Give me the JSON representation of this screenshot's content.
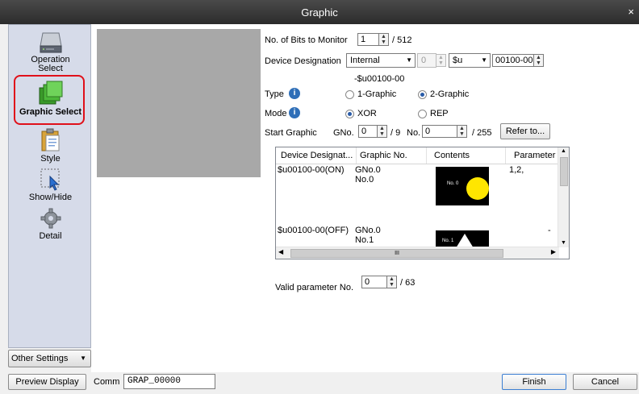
{
  "window": {
    "title": "Graphic",
    "close_glyph": "×"
  },
  "sidebar": {
    "items": [
      {
        "label": "Operation\nSelect",
        "icon": "drive-icon"
      },
      {
        "label": "Graphic Select",
        "icon": "graphic-select-icon"
      },
      {
        "label": "Style",
        "icon": "clipboard-icon"
      },
      {
        "label": "Show/Hide",
        "icon": "cursor-select-icon"
      },
      {
        "label": "Detail",
        "icon": "gear-icon"
      }
    ],
    "selected": "Graphic Select",
    "highlight_color": "#e0101a"
  },
  "other_settings": {
    "label": "Other Settings"
  },
  "form": {
    "bits_label": "No. of Bits to Monitor",
    "bits_value": "1",
    "bits_max": "/ 512",
    "device_label": "Device Designation",
    "device_combo": "Internal",
    "device_num": "0",
    "device_type": "$u",
    "device_addr": "00100-00",
    "device_address_text": "-$u00100-00",
    "type_label": "Type",
    "type_options": [
      "1-Graphic",
      "2-Graphic"
    ],
    "type_selected": "2-Graphic",
    "mode_label": "Mode",
    "mode_options": [
      "XOR",
      "REP"
    ],
    "mode_selected": "XOR",
    "start_label": "Start Graphic",
    "gno_label": "GNo.",
    "gno_value": "0",
    "gno_max": "/ 9",
    "no_label": "No.",
    "no_value": "0",
    "no_max": "/ 255",
    "refer_button": "Refer to...",
    "valid_label": "Valid parameter No.",
    "valid_value": "0",
    "valid_max": "/ 63"
  },
  "table": {
    "columns": [
      "Device Designat...",
      "Graphic No.",
      "Contents",
      "Parameter I"
    ],
    "rows": [
      {
        "device": "$u00100-00(ON)",
        "gno": "GNo.0",
        "no": "No.0",
        "thumb_label": "No. 0",
        "param": "1,2,"
      },
      {
        "device": "$u00100-00(OFF)",
        "gno": "GNo.0",
        "no": "No.1",
        "thumb_label": "No. 1",
        "param": "-"
      }
    ],
    "hscroll_grip": "III"
  },
  "bottom": {
    "preview_button": "Preview Display",
    "comm_label": "Comm",
    "comm_value": "GRAP_00000",
    "finish_button": "Finish",
    "cancel_button": "Cancel"
  }
}
